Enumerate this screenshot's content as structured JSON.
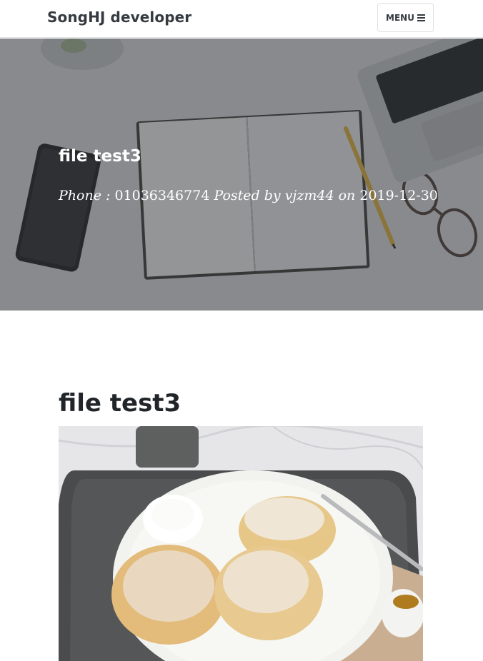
{
  "navbar": {
    "brand": "SongHJ developer",
    "menu_label": "MENU"
  },
  "hero": {
    "title": "file test3",
    "phone_label": "Phone :",
    "phone_number": "01036346774",
    "posted_by_label": "Posted by",
    "author": "vjzm44",
    "on_label": "on",
    "date": "2019-12-30"
  },
  "post": {
    "title": "file test3"
  },
  "icons": {
    "menu": "hamburger-icon"
  }
}
